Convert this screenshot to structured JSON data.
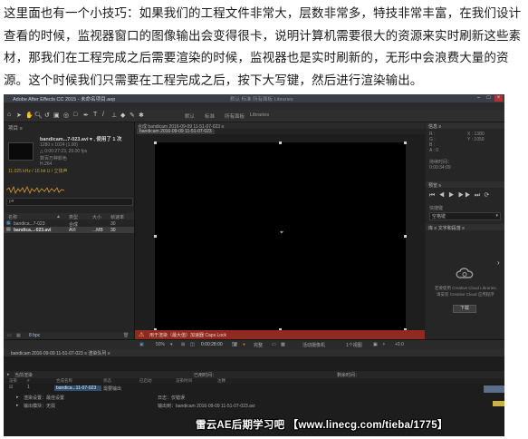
{
  "article": {
    "paragraph": "这里面也有一个小技巧：如果我们的工程文件非常大，层数非常多，特技非常丰富，在我们设计查看的时候，监视器窗口的图像输出会变得很卡，说明计算机需要很大的资源来实时刷新这些素材，那我们在工程完成之后需要渲染的时候，监视器也是实时刷新的，无形中会浪费大量的资源。这个时候我们只需要在工程完成之后，按下大写键，然后进行渲染输出。"
  },
  "ae": {
    "window_title": "Adobe After Effects CC 2015 - 未命名项目.aep",
    "title_center": "默认  标准  所有面板  Libraries",
    "project": {
      "tab": "项目  ≡",
      "name": "bandicam...7-023.avi ▾ , 使用了 1 次",
      "info1": "1280 x 1024 (1.00)",
      "info2": "△ 0:00:27:23, 29.00 fps",
      "info3": "数百万种颜色",
      "info4": "H.264",
      "info5": "11.025 kHz / 16 bit U / 立体声",
      "search_placeholder": "ρ▾",
      "columns": [
        "名称",
        "▲",
        "类型",
        "大小",
        "帧速率"
      ],
      "rows": [
        {
          "name": "bandica...7-023",
          "type": "合成",
          "size": "",
          "fps": "30"
        },
        {
          "name": "bandica...-023.avi",
          "type": "AVI",
          "size": "...MB",
          "fps": "30"
        }
      ],
      "footer": "8 bpc"
    },
    "composition": {
      "tab": "合成 bandicam 2016-09-09 11-51-07-023  ≡",
      "chip": "bandicam 2016-09-09 11-51-07-023",
      "warning": "用于渲染（最大值）加速器  Caps Lock"
    },
    "right_panel": {
      "info_tab": "信息 ≡",
      "info_r": "R :",
      "info_g": "G :",
      "info_b": "B :",
      "info_a": "A : 0",
      "info_x": "X : 1380",
      "info_y": "Y : 1050",
      "time_label": "持续时间：",
      "time_value": "0:00:34:09",
      "preview_tab": "预览 ≡",
      "controls": "⏮ ◀ ▶ ▶▶ ⏭  ⟳",
      "shortcut_label": "快捷键",
      "shortcut_value": "空格键",
      "libraries_tab": "库 ≡  文字和段落 ≡",
      "cc_text1": "若要使用 Creative Cloud Libraries,",
      "cc_text2": "请安装 Creative Cloud 应用程序",
      "cc_button": "下载"
    },
    "viewer_bar": {
      "zoom": "50%",
      "timecode": "0:00:28:00",
      "resolution": "完整",
      "camera": "活动摄像机",
      "views": "1个视图",
      "offset": "+0.0"
    },
    "timeline": {
      "tab": "bandicam 2016-09-09 11-51-07-023 ≡   渲染队列 ≡",
      "status_left": "当前渲染",
      "status_mid": "已用时间：",
      "status_right": "剩余时间：",
      "columns": [
        "渲染",
        "#",
        "合成名称",
        "状态",
        "已启动",
        "渲染时间",
        "注释"
      ],
      "row1_label": "bandica...11-07-023",
      "row1_status": "需要输出",
      "row2_label": "渲染设置：最佳设置",
      "row2_value": "日志：仅错误",
      "row3_label": "输出模块：无损",
      "row3_value": "输出到：bandicam 2016-09-09 11-51-07-023.avi"
    },
    "watermark": "雷云AE后期学习吧 【www.linecg.com/tieba/1775】"
  }
}
